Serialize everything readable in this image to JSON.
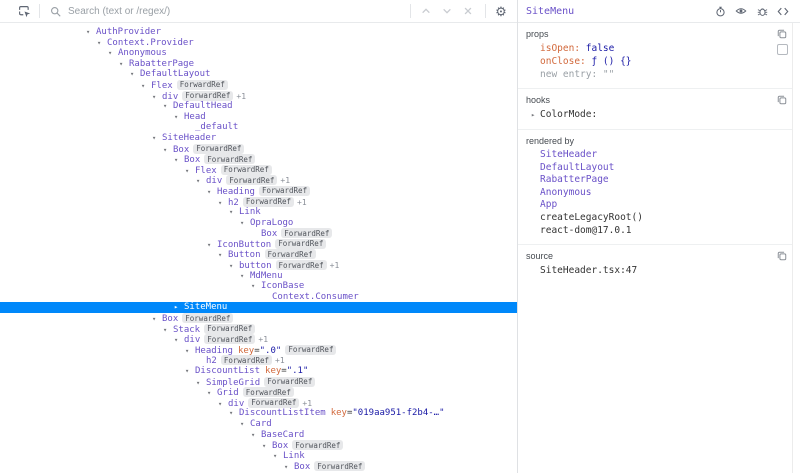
{
  "toolbar": {
    "search_placeholder": "Search (text or /regex/)",
    "icons": [
      "inspect-icon",
      "search-icon",
      "prev-match-icon",
      "next-match-icon",
      "clear-search-icon",
      "settings-gear-icon"
    ]
  },
  "inspector_header": {
    "title": "SiteMenu",
    "icons": [
      "timer-icon",
      "eye-icon",
      "bug-icon",
      "view-source-icon"
    ]
  },
  "tree": {
    "rows": [
      {
        "name": "AuthProvider",
        "depth": 0,
        "arrow": "down"
      },
      {
        "name": "Context.Provider",
        "depth": 1,
        "arrow": "down"
      },
      {
        "name": "Anonymous",
        "depth": 2,
        "arrow": "down"
      },
      {
        "name": "RabatterPage",
        "depth": 3,
        "arrow": "down"
      },
      {
        "name": "DefaultLayout",
        "depth": 4,
        "arrow": "down"
      },
      {
        "name": "Flex",
        "depth": 5,
        "arrow": "down",
        "badge": "ForwardRef"
      },
      {
        "name": "div",
        "depth": 6,
        "arrow": "down",
        "badge": "ForwardRef",
        "plus": "+1"
      },
      {
        "name": "DefaultHead",
        "depth": 7,
        "arrow": "down"
      },
      {
        "name": "Head",
        "depth": 8,
        "arrow": "down"
      },
      {
        "name": "_default",
        "depth": 9,
        "arrow": null
      },
      {
        "name": "SiteHeader",
        "depth": 6,
        "arrow": "down"
      },
      {
        "name": "Box",
        "depth": 7,
        "arrow": "down",
        "badge": "ForwardRef"
      },
      {
        "name": "Box",
        "depth": 8,
        "arrow": "down",
        "badge": "ForwardRef"
      },
      {
        "name": "Flex",
        "depth": 9,
        "arrow": "down",
        "badge": "ForwardRef"
      },
      {
        "name": "div",
        "depth": 10,
        "arrow": "down",
        "badge": "ForwardRef",
        "plus": "+1"
      },
      {
        "name": "Heading",
        "depth": 11,
        "arrow": "down",
        "badge": "ForwardRef"
      },
      {
        "name": "h2",
        "depth": 12,
        "arrow": "down",
        "badge": "ForwardRef",
        "plus": "+1"
      },
      {
        "name": "Link",
        "depth": 13,
        "arrow": "down"
      },
      {
        "name": "OpraLogo",
        "depth": 14,
        "arrow": "down"
      },
      {
        "name": "Box",
        "depth": 15,
        "arrow": null,
        "badge": "ForwardRef"
      },
      {
        "name": "IconButton",
        "depth": 11,
        "arrow": "down",
        "badge": "ForwardRef"
      },
      {
        "name": "Button",
        "depth": 12,
        "arrow": "down",
        "badge": "ForwardRef"
      },
      {
        "name": "button",
        "depth": 13,
        "arrow": "down",
        "badge": "ForwardRef",
        "plus": "+1"
      },
      {
        "name": "MdMenu",
        "depth": 14,
        "arrow": "down"
      },
      {
        "name": "IconBase",
        "depth": 15,
        "arrow": "down"
      },
      {
        "name": "Context.Consumer",
        "depth": 16,
        "arrow": null
      },
      {
        "name": "SiteMenu",
        "depth": 8,
        "arrow": "right",
        "selected": true
      },
      {
        "name": "Box",
        "depth": 6,
        "arrow": "down",
        "badge": "ForwardRef"
      },
      {
        "name": "Stack",
        "depth": 7,
        "arrow": "down",
        "badge": "ForwardRef"
      },
      {
        "name": "div",
        "depth": 8,
        "arrow": "down",
        "badge": "ForwardRef",
        "plus": "+1"
      },
      {
        "name": "Heading",
        "depth": 9,
        "arrow": "down",
        "key": ".0",
        "badge": "ForwardRef"
      },
      {
        "name": "h2",
        "depth": 10,
        "arrow": null,
        "badge": "ForwardRef",
        "plus": "+1"
      },
      {
        "name": "DiscountList",
        "depth": 9,
        "arrow": "down",
        "key": ".1"
      },
      {
        "name": "SimpleGrid",
        "depth": 10,
        "arrow": "down",
        "badge": "ForwardRef"
      },
      {
        "name": "Grid",
        "depth": 11,
        "arrow": "down",
        "badge": "ForwardRef"
      },
      {
        "name": "div",
        "depth": 12,
        "arrow": "down",
        "badge": "ForwardRef",
        "plus": "+1"
      },
      {
        "name": "DiscountListItem",
        "depth": 13,
        "arrow": "down",
        "key": "019aa951-f2b4-…"
      },
      {
        "name": "Card",
        "depth": 14,
        "arrow": "down"
      },
      {
        "name": "BaseCard",
        "depth": 15,
        "arrow": "down"
      },
      {
        "name": "Box",
        "depth": 16,
        "arrow": "down",
        "badge": "ForwardRef"
      },
      {
        "name": "Link",
        "depth": 17,
        "arrow": "down"
      },
      {
        "name": "Box",
        "depth": 18,
        "arrow": "down",
        "badge": "ForwardRef"
      }
    ]
  },
  "inspector": {
    "props": {
      "title": "props",
      "items": [
        {
          "name": "isOpen",
          "value": "false",
          "kind": "boolean",
          "editable": true
        },
        {
          "name": "onClose",
          "value": "ƒ () {}",
          "kind": "function",
          "editable": false
        }
      ],
      "new_entry": {
        "label": "new entry",
        "value": "\"\""
      }
    },
    "hooks": {
      "title": "hooks",
      "items": [
        {
          "name": "ColorMode",
          "suffix": ":",
          "collapsed": true
        }
      ]
    },
    "rendered_by": {
      "title": "rendered by",
      "items": [
        {
          "label": "SiteHeader",
          "link": true
        },
        {
          "label": "DefaultLayout",
          "link": true
        },
        {
          "label": "RabatterPage",
          "link": true
        },
        {
          "label": "Anonymous",
          "link": true
        },
        {
          "label": "App",
          "link": true
        },
        {
          "label": "createLegacyRoot()",
          "link": false
        },
        {
          "label": "react-dom@17.0.1",
          "link": false
        }
      ]
    },
    "source": {
      "title": "source",
      "file": "SiteHeader.tsx:47"
    }
  },
  "colors": {
    "component_name": "#6a51c8",
    "selected_row_bg": "#0088fa",
    "attribute_name": "#d2693c",
    "attribute_value": "#1a1aa6",
    "badge_bg": "#e7e8ea",
    "muted_icon": "#5f6673",
    "disabled_icon": "#c9ccd1"
  }
}
